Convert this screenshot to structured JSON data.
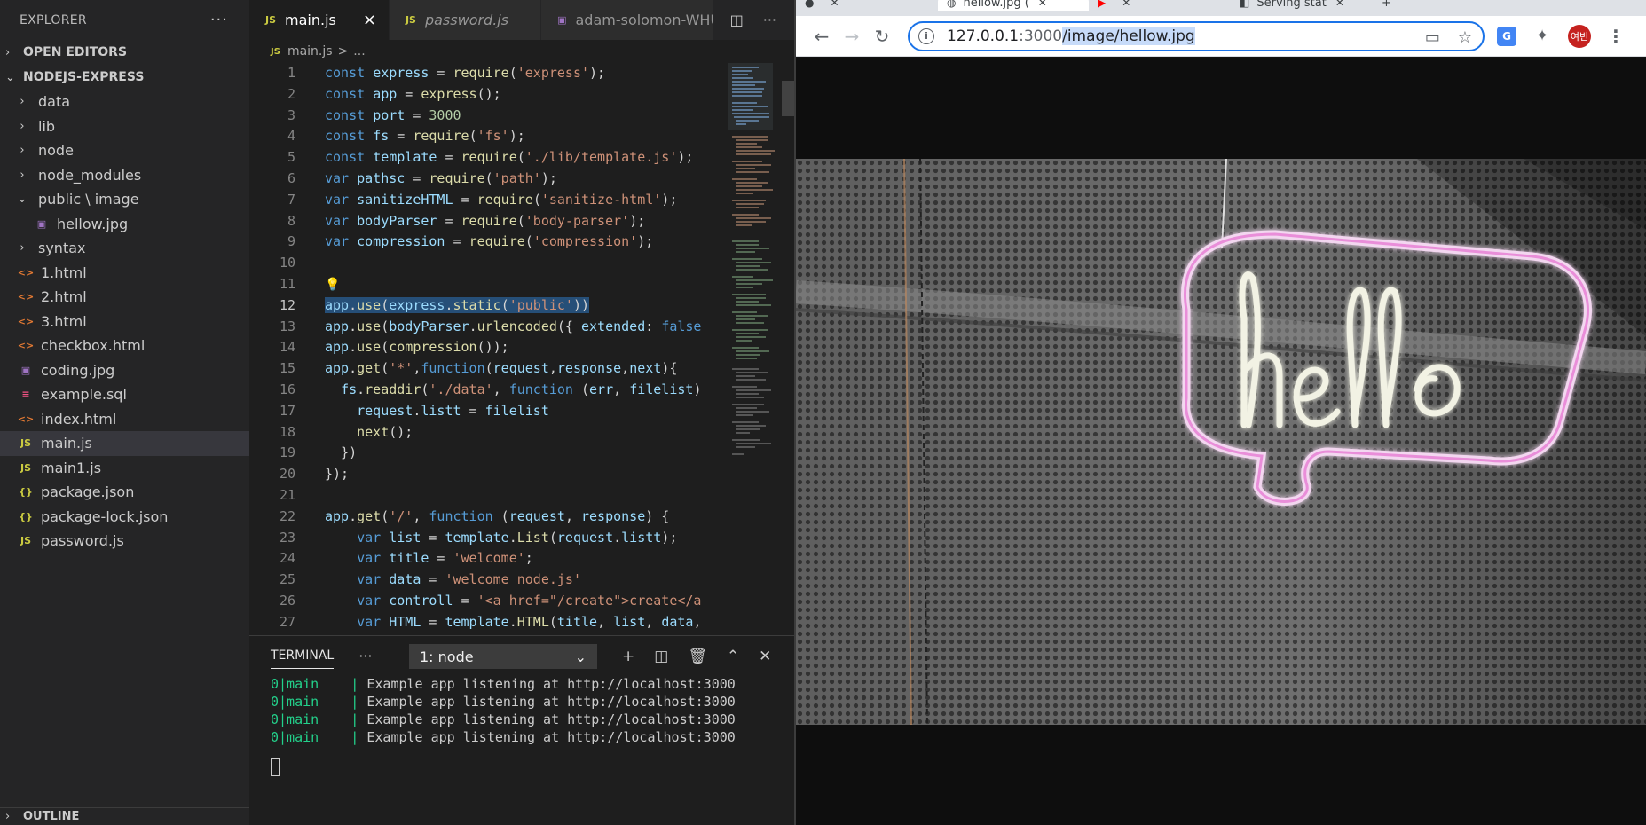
{
  "explorer": {
    "title": "EXPLORER",
    "dots": "···",
    "open_editors": "OPEN EDITORS",
    "project": "NODEJS-EXPRESS",
    "items": [
      {
        "chev": "›",
        "label": "data",
        "type": "folder",
        "indent": 0
      },
      {
        "chev": "›",
        "label": "lib",
        "type": "folder",
        "indent": 0
      },
      {
        "chev": "›",
        "label": "node",
        "type": "folder",
        "indent": 0
      },
      {
        "chev": "›",
        "label": "node_modules",
        "type": "folder",
        "indent": 0
      },
      {
        "chev": "⌄",
        "label": "public \\ image",
        "type": "folder",
        "indent": 0
      },
      {
        "icon": "▣",
        "label": "hellow.jpg",
        "type": "img",
        "indent": 1
      },
      {
        "chev": "›",
        "label": "syntax",
        "type": "folder",
        "indent": 0
      },
      {
        "icon": "<>",
        "label": "1.html",
        "type": "html",
        "indent": 0
      },
      {
        "icon": "<>",
        "label": "2.html",
        "type": "html",
        "indent": 0
      },
      {
        "icon": "<>",
        "label": "3.html",
        "type": "html",
        "indent": 0
      },
      {
        "icon": "<>",
        "label": "checkbox.html",
        "type": "html",
        "indent": 0
      },
      {
        "icon": "▣",
        "label": "coding.jpg",
        "type": "img",
        "indent": 0
      },
      {
        "icon": "≡",
        "label": "example.sql",
        "type": "sql",
        "indent": 0
      },
      {
        "icon": "<>",
        "label": "index.html",
        "type": "html",
        "indent": 0
      },
      {
        "icon": "JS",
        "label": "main.js",
        "type": "js",
        "indent": 0,
        "active": true
      },
      {
        "icon": "JS",
        "label": "main1.js",
        "type": "js",
        "indent": 0
      },
      {
        "icon": "{}",
        "label": "package.json",
        "type": "json",
        "indent": 0
      },
      {
        "icon": "{}",
        "label": "package-lock.json",
        "type": "json",
        "indent": 0
      },
      {
        "icon": "JS",
        "label": "password.js",
        "type": "js",
        "indent": 0
      }
    ],
    "outline": "OUTLINE"
  },
  "editor": {
    "tabs": [
      {
        "icon": "JS",
        "label": "main.js",
        "active": true,
        "close": "×"
      },
      {
        "icon": "JS",
        "label": "password.js",
        "active": false
      },
      {
        "icon": "▣",
        "label": "adam-solomon-WHUDC",
        "active": false
      }
    ],
    "breadcrumb": {
      "icon": "JS",
      "file": "main.js",
      "sep": ">",
      "rest": "..."
    }
  },
  "terminal": {
    "title": "TERMINAL",
    "dots": "···",
    "selected": "1: node",
    "lines": [
      {
        "proc": "0|main",
        "sep": "    |",
        "text": " Example app listening at http://localhost:3000"
      },
      {
        "proc": "0|main",
        "sep": "    |",
        "text": " Example app listening at http://localhost:3000"
      },
      {
        "proc": "0|main",
        "sep": "    |",
        "text": " Example app listening at http://localhost:3000"
      },
      {
        "proc": "0|main",
        "sep": "    |",
        "text": " Example app listening at http://localhost:3000"
      }
    ]
  },
  "browser": {
    "tabs": [
      "",
      "hellow.jpg (",
      "",
      "Serving stat"
    ],
    "url_host": "127.0.0.1",
    "url_port": ":3000",
    "url_path": "/image/hellow.jpg",
    "avatar": "여빈"
  },
  "colors": {
    "accent": "#1a73e8",
    "vscode_bg": "#1e1e1e",
    "sidebar_bg": "#252526"
  }
}
